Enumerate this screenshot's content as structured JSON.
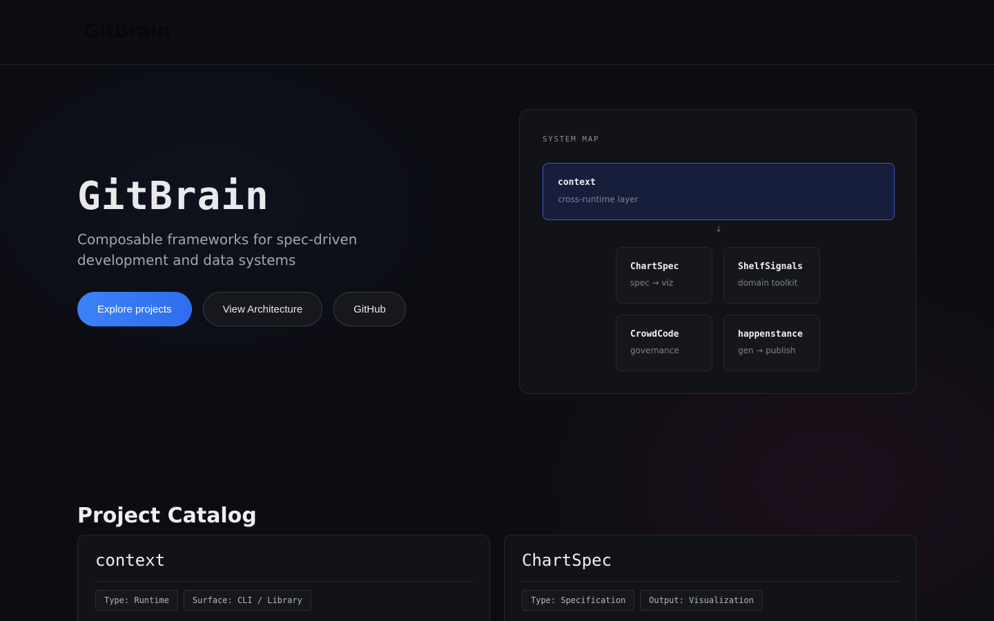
{
  "header": {
    "brand": "GitBrain"
  },
  "hero": {
    "title": "GitBrain",
    "subtitle": "Composable frameworks for spec-driven development and data systems",
    "buttons": [
      {
        "label": "Explore projects"
      },
      {
        "label": "View Architecture"
      },
      {
        "label": "GitHub"
      }
    ]
  },
  "system_map": {
    "label": "SYSTEM MAP",
    "root": {
      "title": "context",
      "subtitle": "cross-runtime layer"
    },
    "arrow": "↓",
    "nodes": [
      {
        "title": "ChartSpec",
        "subtitle": "spec → viz"
      },
      {
        "title": "ShelfSignals",
        "subtitle": "domain toolkit"
      },
      {
        "title": "CrowdCode",
        "subtitle": "governance"
      },
      {
        "title": "happenstance",
        "subtitle": "gen → publish"
      }
    ]
  },
  "catalog": {
    "title": "Project Catalog",
    "cards": [
      {
        "title": "context",
        "tags": [
          "Type: Runtime",
          "Surface: CLI / Library"
        ]
      },
      {
        "title": "ChartSpec",
        "tags": [
          "Type: Specification",
          "Output: Visualization"
        ]
      }
    ]
  },
  "colors": {
    "background": "#0c0d12",
    "primary_button": "#3b82f6",
    "root_node_border": "#3b5bc9",
    "root_node_fill": "#171e3c"
  }
}
